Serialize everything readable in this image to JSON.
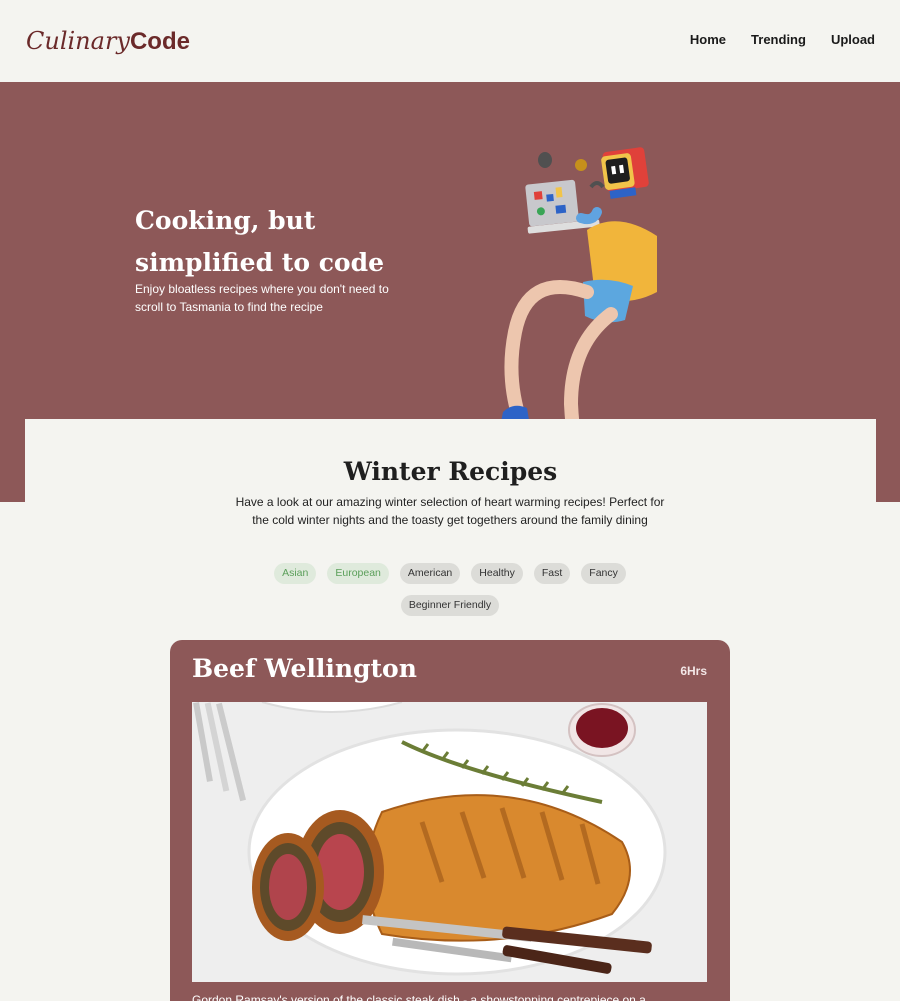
{
  "header": {
    "logo_italic": "Culinary",
    "logo_bold": "Code",
    "nav": [
      "Home",
      "Trending",
      "Upload"
    ]
  },
  "hero": {
    "title": "Cooking, but simplified to code",
    "subtitle": "Enjoy bloatless recipes where you don't need to scroll to Tasmania to find the recipe",
    "illustration": "character-with-laptop-illustration"
  },
  "winter": {
    "title": "Winter Recipes",
    "description": "Have a look at our amazing winter selection of heart warming recipes! Perfect for the cold winter nights and the toasty get togethers around the family dining",
    "tags": [
      {
        "label": "Asian",
        "selected": true
      },
      {
        "label": "European",
        "selected": true
      },
      {
        "label": "American",
        "selected": false
      },
      {
        "label": "Healthy",
        "selected": false
      },
      {
        "label": "Fast",
        "selected": false
      },
      {
        "label": "Fancy",
        "selected": false
      },
      {
        "label": "Beginner Friendly",
        "selected": false
      }
    ]
  },
  "recipe": {
    "title": "Beef Wellington",
    "time": "6Hrs",
    "description": "Gordon Ramsay's version of the classic steak dish - a showstopping centrepiece on a",
    "image": "beef-wellington-photo"
  },
  "colors": {
    "brand": "#8d5858",
    "logo": "#6b2a2a",
    "background": "#f4f4f0",
    "tag_selected_text": "#5b9f5a",
    "tag_selected_bg": "#dfeadc"
  }
}
